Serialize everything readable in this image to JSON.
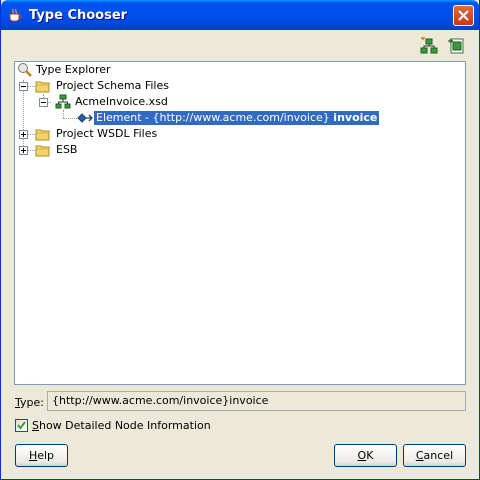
{
  "window": {
    "title": "Type Chooser"
  },
  "toolbar": {
    "add_icon": "add-schema-icon",
    "import_icon": "import-schema-icon"
  },
  "tree": {
    "root": {
      "label": "Type Explorer",
      "icon": "type-explorer-icon"
    },
    "project_schema_files": {
      "label": "Project Schema Files",
      "expanded": true
    },
    "acme_invoice": {
      "label": "AcmeInvoice.xsd",
      "expanded": true
    },
    "element": {
      "label_prefix": "Element - {http://www.acme.com/invoice}",
      "label_name": "invoice",
      "selected": true
    },
    "project_wsdl_files": {
      "label": "Project WSDL Files",
      "expanded": false
    },
    "esb": {
      "label": "ESB",
      "expanded": false
    }
  },
  "type_field": {
    "label_first": "T",
    "label_rest": "ype:",
    "value": "{http://www.acme.com/invoice}invoice"
  },
  "detail_checkbox": {
    "label_first": "S",
    "label_rest": "how Detailed Node Information",
    "checked": true
  },
  "buttons": {
    "help": {
      "first": "H",
      "rest": "elp"
    },
    "ok": {
      "first": "O",
      "rest": "K"
    },
    "cancel": {
      "first": "C",
      "rest": "ancel"
    }
  },
  "colors": {
    "selection": "#316ac5",
    "titlebar": "#0054e3",
    "folder": "#f5d56b"
  }
}
